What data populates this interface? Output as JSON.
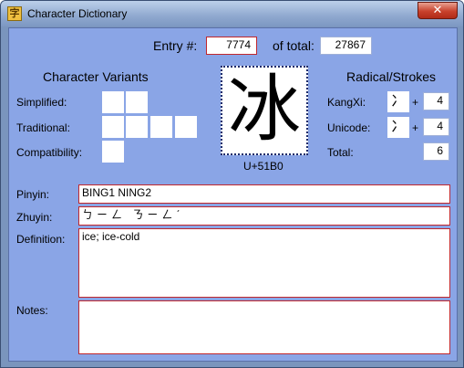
{
  "window": {
    "title": "Character Dictionary",
    "close_glyph": "✕"
  },
  "entry": {
    "label": "Entry #:",
    "value": "7774",
    "of_total_label": "of total:",
    "total": "27867"
  },
  "variants": {
    "heading": "Character Variants",
    "simplified_label": "Simplified:",
    "traditional_label": "Traditional:",
    "compatibility_label": "Compatibility:"
  },
  "glyph": {
    "character": "冰",
    "codepoint": "U+51B0"
  },
  "radical": {
    "heading": "Radical/Strokes",
    "kangxi_label": "KangXi:",
    "kangxi_radical": "冫",
    "kangxi_plus": "+",
    "kangxi_strokes": "4",
    "unicode_label": "Unicode:",
    "unicode_radical": "冫",
    "unicode_plus": "+",
    "unicode_strokes": "4",
    "total_label": "Total:",
    "total_strokes": "6"
  },
  "details": {
    "pinyin_label": "Pinyin:",
    "pinyin": "BING1 NING2",
    "zhuyin_label": "Zhuyin:",
    "zhuyin": "ㄅㄧㄥ ㄋㄧㄥˊ",
    "definition_label": "Definition:",
    "definition": "ice; ice-cold",
    "notes_label": "Notes:",
    "notes": ""
  },
  "icons": {
    "app": "dictionary-app-icon",
    "close": "close-icon"
  },
  "colors": {
    "client_bg": "#8aa5e6",
    "field_border": "#c0272d",
    "titlebar": "#8fa8cf"
  }
}
